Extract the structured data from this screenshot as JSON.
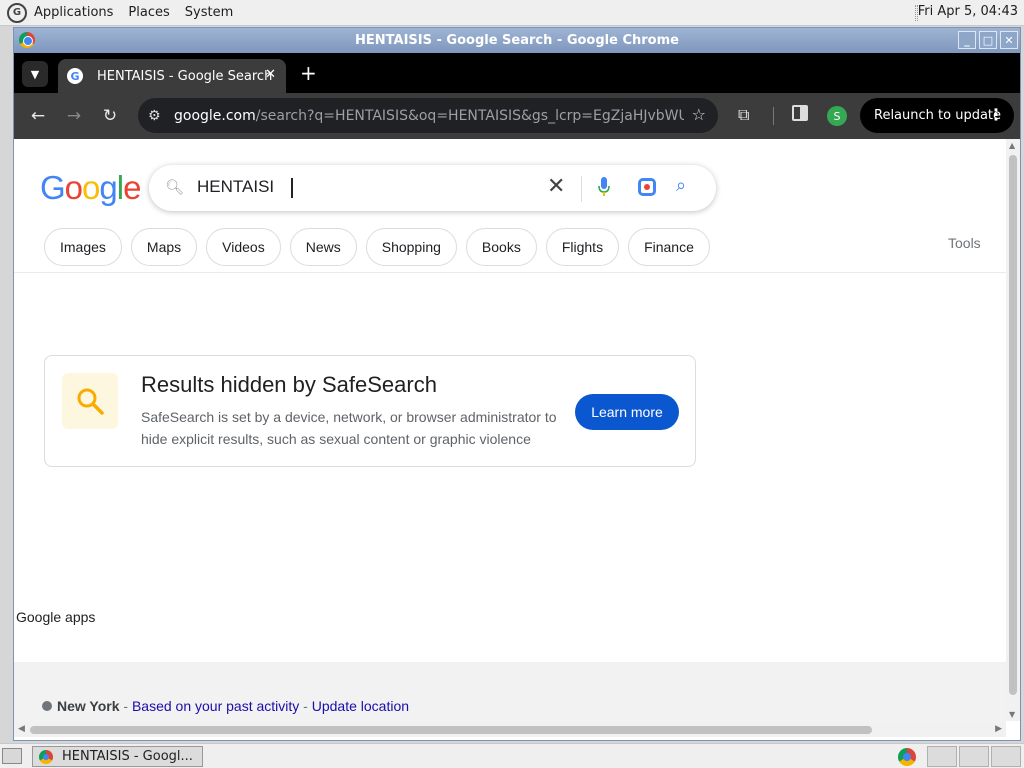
{
  "top_panel": {
    "menus": [
      "Applications",
      "Places",
      "System"
    ],
    "clock": "Fri Apr 5, 04:43"
  },
  "window": {
    "title": "HENTAISIS - Google Search - Google Chrome",
    "controls": [
      "_",
      "□",
      "✕"
    ]
  },
  "tabs": [
    {
      "title": "HENTAISIS - Google Search"
    }
  ],
  "toolbar": {
    "url_host": "google.com",
    "url_path": "/search?q=HENTAISIS&oq=HENTAISIS&gs_lcrp=EgZjaHJvbWUyBg...",
    "profile_initial": "S",
    "relaunch_label": "Relaunch to update"
  },
  "search": {
    "query": "HENTAISI",
    "logo_letters": [
      "G",
      "o",
      "o",
      "g",
      "l",
      "e"
    ]
  },
  "chips": [
    "Images",
    "Maps",
    "Videos",
    "News",
    "Shopping",
    "Books",
    "Flights",
    "Finance"
  ],
  "tools_label": "Tools",
  "safesearch": {
    "title": "Results hidden by SafeSearch",
    "description": "SafeSearch is set by a device, network, or browser administrator to hide explicit results, such as sexual content or graphic violence",
    "button": "Learn more"
  },
  "google_apps_label": "Google apps",
  "footer": {
    "city": "New York",
    "sep1": " - ",
    "link1": "Based on your past activity",
    "sep2": " - ",
    "link2": "Update location"
  },
  "taskbar": {
    "task_label": "HENTAISIS - Googl..."
  },
  "colors": {
    "accent_blue": "#0b57d0",
    "link": "#1a0dab",
    "safesearch_icon_bg": "#fef7e0"
  }
}
